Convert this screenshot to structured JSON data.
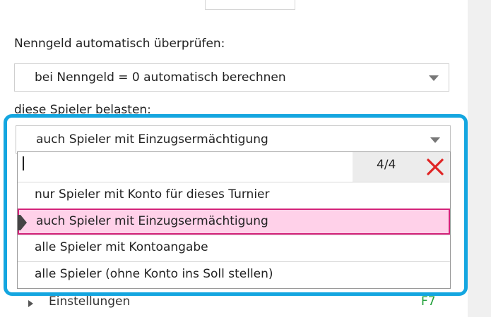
{
  "form": {
    "fee_check_label": "Nenngeld automatisch überprüfen:",
    "fee_check_select": "bei Nenngeld = 0 automatisch berechnen",
    "charge_players_label": "diese Spieler belasten:",
    "charge_players_select": "auch Spieler mit Einzugsermächtigung"
  },
  "dropdown": {
    "search_value": "",
    "counter": "4/4",
    "selected_index": 1,
    "options": [
      "nur Spieler mit Konto für dieses Turnier",
      "auch Spieler mit Einzugsermächtigung",
      "alle Spieler mit Kontoangabe",
      "alle Spieler (ohne Konto ins Soll stellen)"
    ]
  },
  "settings": {
    "label": "Einstellungen",
    "shortcut": "F7"
  },
  "colors": {
    "highlight": "#14a6e0",
    "selected_bg": "#ffd1e9",
    "selected_border": "#d4237a",
    "clear_icon": "#e02424",
    "shortcut_text": "#22a03a"
  },
  "icons": [
    "chevron-down-icon",
    "clear-x-icon",
    "selected-marker-icon",
    "expand-arrow-icon"
  ]
}
